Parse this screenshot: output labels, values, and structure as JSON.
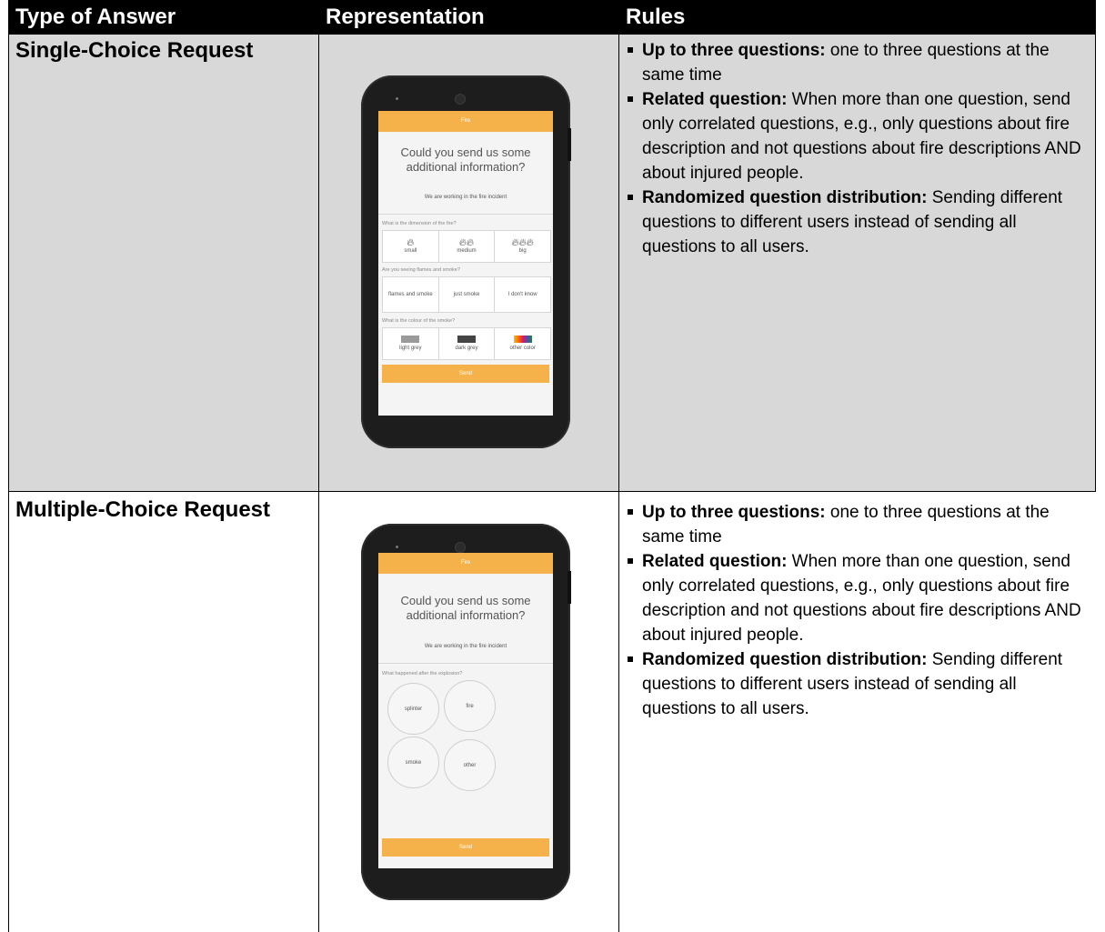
{
  "table": {
    "headers": [
      "Type of Answer",
      "Representation",
      "Rules"
    ],
    "rows": [
      {
        "type": "Single-Choice Request",
        "rules": [
          {
            "bold": "Up to three questions:",
            "text": " one to three questions at the same time"
          },
          {
            "bold": "Related question:",
            "text": " When more than one question, send only correlated questions, e.g., only questions about fire description and not questions about fire descriptions AND about injured people."
          },
          {
            "bold": "Randomized question distribution:",
            "text": " Sending different questions to different users instead of sending all questions to all users."
          }
        ],
        "phone": {
          "topbar": "Fire",
          "title": "Could you send us some additional information?",
          "subtitle": "We are working in the fire incident",
          "questions": [
            {
              "label": "What is the dimension of the fire?",
              "options": [
                "small",
                "medium",
                "big"
              ],
              "icons": [
                "flame-1-icon",
                "flame-2-icon",
                "flame-3-icon"
              ]
            },
            {
              "label": "Are you seeing flames and smoke?",
              "options": [
                "flames and smoke",
                "just smoke",
                "I don't know"
              ]
            },
            {
              "label": "What is the colour of the smoke?",
              "options": [
                "light grey",
                "dark grey",
                "other color"
              ],
              "swatch_colors": [
                "#9a9a9a",
                "#444444",
                "rainbow"
              ]
            }
          ],
          "send": "Send"
        }
      },
      {
        "type": "Multiple-Choice Request",
        "rules": [
          {
            "bold": "Up to three questions:",
            "text": " one to three questions at the same time"
          },
          {
            "bold": "Related question:",
            "text": " When more than one question, send only correlated questions, e.g., only questions about fire description and not questions about fire descriptions AND about injured people."
          },
          {
            "bold": "Randomized question distribution:",
            "text": " Sending different questions to different users instead of sending all questions to all users."
          }
        ],
        "phone": {
          "topbar": "Fire",
          "title": "Could you send us some additional information?",
          "subtitle": "We are working in the fire incident",
          "question": "What happened after the explosion?",
          "options": [
            "splinter",
            "fire",
            "smoke",
            "other"
          ],
          "send": "Send"
        }
      }
    ]
  },
  "colors": {
    "header_bg": "#000000",
    "row1_bg": "#d8d8d8",
    "accent": "#f5b24a"
  }
}
